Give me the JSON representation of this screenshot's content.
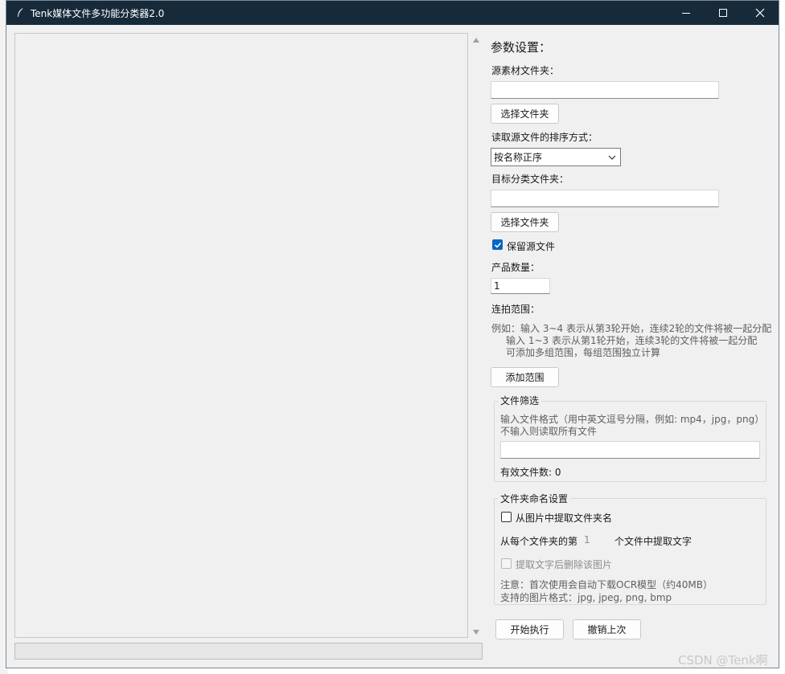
{
  "window": {
    "title": "Tenk媒体文件多功能分类器2.0"
  },
  "progress": {
    "value": 0
  },
  "params": {
    "heading": "参数设置：",
    "source_label": "源素材文件夹：",
    "source_value": "",
    "choose_folder_label": "选择文件夹",
    "sort_label": "读取源文件的排序方式：",
    "sort_selected": "按名称正序",
    "target_label": "目标分类文件夹：",
    "target_value": "",
    "choose_target_label": "选择文件夹",
    "keep_source_label": "保留源文件",
    "keep_source_checked": true,
    "product_count_label": "产品数量：",
    "product_count_value": "1",
    "burst_range_label": "连拍范围：",
    "burst_help": [
      "例如：输入 3~4 表示从第3轮开始，连续2轮的文件将被一起分配",
      "输入 1~3 表示从第1轮开始，连续3轮的文件将被一起分配",
      "可添加多组范围，每组范围独立计算"
    ],
    "add_range_label": "添加范围"
  },
  "file_filter": {
    "title": "文件筛选",
    "hint_line1": "输入文件格式（用中英文逗号分隔，例如: mp4，jpg，png）",
    "hint_line2": "不输入则读取所有文件",
    "value": "",
    "valid_count_label": "有效文件数: 0"
  },
  "folder_naming": {
    "title": "文件夹命名设置",
    "extract_from_image_label": "从图片中提取文件夹名",
    "extract_from_image_checked": false,
    "nth_prefix": "从每个文件夹的第",
    "nth_value": "1",
    "nth_suffix": "个文件中提取文字",
    "delete_after_label": "提取文字后删除该图片",
    "delete_after_checked": false,
    "note_line1": "注意：首次使用会自动下载OCR模型（约40MB）",
    "note_line2": "支持的图片格式：jpg, jpeg, png, bmp"
  },
  "actions": {
    "start_label": "开始执行",
    "undo_label": "撤销上次"
  },
  "watermark": "CSDN @Tenk啊",
  "colors": {
    "titlebar": "#172a3a",
    "accent": "#0067c0"
  }
}
